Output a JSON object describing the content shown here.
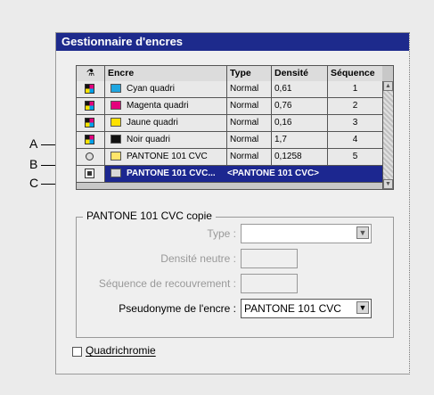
{
  "dialog": {
    "title": "Gestionnaire d'encres",
    "table": {
      "headers": {
        "icon": "⚗",
        "ink": "Encre",
        "type": "Type",
        "density": "Densité",
        "sequence": "Séquence"
      },
      "rows": [
        {
          "icon": "process-cmyk-icon",
          "swatch": "#1fa6e0",
          "ink": "Cyan quadri",
          "type": "Normal",
          "density": "0,61",
          "sequence": "1"
        },
        {
          "icon": "process-cmyk-icon",
          "swatch": "#e4007c",
          "ink": "Magenta quadri",
          "type": "Normal",
          "density": "0,76",
          "sequence": "2"
        },
        {
          "icon": "process-cmyk-icon",
          "swatch": "#ffe100",
          "ink": "Jaune quadri",
          "type": "Normal",
          "density": "0,16",
          "sequence": "3"
        },
        {
          "icon": "process-cmyk-icon",
          "swatch": "#111111",
          "ink": "Noir quadri",
          "type": "Normal",
          "density": "1,7",
          "sequence": "4"
        },
        {
          "icon": "spot-ink-icon",
          "swatch": "#ffe56b",
          "ink": "PANTONE 101 CVC",
          "type": "Normal",
          "density": "0,1258",
          "sequence": "5"
        },
        {
          "icon": "ink-alias-icon",
          "swatch": "#d8d8d8",
          "ink": "PANTONE 101 CVC...",
          "alias_text": "<PANTONE 101 CVC>",
          "selected": true
        }
      ]
    },
    "group_title": "PANTONE 101 CVC copie",
    "fields": {
      "type_label": "Type :",
      "neutral_density_label": "Densité neutre :",
      "trap_sequence_label": "Séquence de recouvrement :",
      "ink_alias_label": "Pseudonyme de l'encre :",
      "ink_alias_value": "PANTONE 101 CVC"
    },
    "checkbox_label": "Quadrichromie"
  },
  "callouts": [
    "A",
    "B",
    "C"
  ],
  "colors": {
    "titlebar": "#1d2a8c",
    "selection": "#1c2790"
  }
}
